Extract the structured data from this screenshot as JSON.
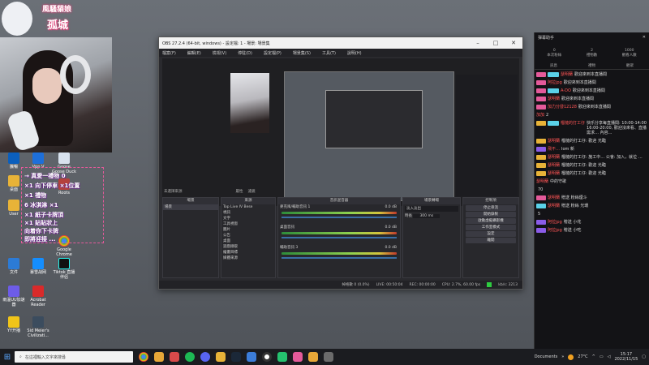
{
  "brand": {
    "line1": "風騷貓娘",
    "line2": "孤城"
  },
  "desktop_icons": [
    {
      "label": "騰暢"
    },
    {
      "label": "Vpp V"
    },
    {
      "label": "Goose Goose Duck"
    },
    {
      "label": "桌面"
    },
    {
      "label": "User"
    },
    {
      "label": "Google Chrome"
    },
    {
      "label": "Roots"
    },
    {
      "label": "文件"
    },
    {
      "label": "暴雪战网"
    },
    {
      "label": "Tiktok 直播伴侣"
    },
    {
      "label": "雨溫UU加速器"
    },
    {
      "label": "Acrobat Reader"
    },
    {
      "label": "YY开播"
    },
    {
      "label": "Sid Meier's Civilizati..."
    }
  ],
  "overlay": {
    "rows": [
      "→ 真愛一禮物 0",
      "×1 向下停車 ×1位置",
      "×1 禮物",
      "6 冰淇淋 ×1",
      "×1 紙子卡牌頂",
      "×1 貼貼狀上",
      "向着你下卡牌",
      "即將迎接 ..."
    ]
  },
  "obs": {
    "title": "OBS 27.2.4 (64-bit, windows) - 設定檔: 1 - 場景: 場景集",
    "menu": [
      "檔案(F)",
      "編輯(E)",
      "檢視(V)",
      "停駐(D)",
      "設定檔(P)",
      "場景集(S)",
      "工具(T)",
      "說明(H)"
    ],
    "toolbar_hint": "未選擇來源",
    "props_label": "屬性",
    "filters_label": "濾鏡",
    "docks": {
      "scenes": {
        "header": "場景",
        "items": [
          "場景"
        ]
      },
      "sources": {
        "header": "來源",
        "items": [
          "Top Live IV Bese",
          "視訊",
          "文字",
          "工具視窗",
          "圖片",
          "公告",
          "桌面",
          "遊戲擷取",
          "繪畫目標",
          "媒體來源"
        ]
      },
      "mixer": {
        "header": "音訊混音器",
        "channels": [
          {
            "name": "麥克風/輔助音訊 1",
            "db": "0.0 dB"
          },
          {
            "name": "桌面音訊",
            "db": "0.0 dB"
          },
          {
            "name": "輔助音訊 3",
            "db": "0.0 dB"
          }
        ]
      },
      "transitions": {
        "header": "場景轉場",
        "type": "淡入淡出",
        "duration_label": "時長",
        "duration": "300 ms"
      },
      "controls": {
        "header": "控制項",
        "buttons": [
          "停止串流",
          "開始錄製",
          "啟動虛擬攝影機",
          "工作室模式",
          "設定",
          "離開"
        ]
      }
    },
    "status": {
      "dropped": "掉格數 0 (0.0%)",
      "live": "LIVE: 00:50:04",
      "rec": "REC: 00:00:00",
      "cpu": "CPU: 2.7%, 60.00 fps",
      "kbps": "kb/s: 3213"
    }
  },
  "chat": {
    "title": "彈幕助手",
    "stats": [
      {
        "label": "本次粉絲",
        "value": "0"
      },
      {
        "label": "禮物數",
        "value": "2"
      },
      {
        "label": "觀看人數",
        "value": "1000"
      }
    ],
    "tabs": [
      "訊息",
      "禮物",
      "觀眾"
    ],
    "messages": [
      {
        "user": "瑟明蘭",
        "text": "歡迎來到本直播間"
      },
      {
        "user": "阿拉jpg",
        "text": "歡迎來到本直播間"
      },
      {
        "user": "A-DO",
        "text": "歡迎來到本直播間"
      },
      {
        "user": "瑟明蘭",
        "text": "歡迎來到本直播間"
      },
      {
        "user": "加力分發12128",
        "text": "歡迎來到本直播間"
      },
      {
        "user": "加加",
        "text": "2"
      },
      {
        "user": "榴槤的打工仔",
        "text": "快乐分享每直播間: 10:00-14:00 16:00-20:00, 歡迎沒來看、直播需求… 內容..."
      },
      {
        "user": "瑟明蘭",
        "text": "榴槤的打工仔: 歡迎 光臨"
      },
      {
        "user": "飛不…",
        "text": "Iom 新"
      },
      {
        "user": "瑟明蘭",
        "text": "榴槤的打工仔: 施工中… 公會: 加入，就位 …"
      },
      {
        "user": "瑟明蘭",
        "text": "榴槤的打工仔: 歡迎 光臨"
      },
      {
        "user": "瑟明蘭",
        "text": "榴槤的打工仔: 歡迎 光臨"
      },
      {
        "user": "瑟明蘭",
        "text": "中的守歌"
      },
      {
        "user": "",
        "text": "70"
      },
      {
        "user": "瑟明蘭",
        "text": "贈送 粉絲煙斗"
      },
      {
        "user": "瑟明蘭",
        "text": "贈送 粉絲 光環"
      },
      {
        "user": "",
        "text": "5"
      },
      {
        "user": "阿拉jpg",
        "text": "贈送 小花"
      },
      {
        "user": "阿拉jpg",
        "text": "贈送 小吃"
      }
    ]
  },
  "taskbar": {
    "search_placeholder": "在這裡輸入文字來搜尋",
    "folder_label": "Documents",
    "temperature": "27°C",
    "time": "15:17",
    "date": "2022/11/15"
  },
  "colors": {
    "accent": "#e45a9a",
    "chat_user": "#ff5555",
    "obs_bg": "#2a2a2e"
  }
}
